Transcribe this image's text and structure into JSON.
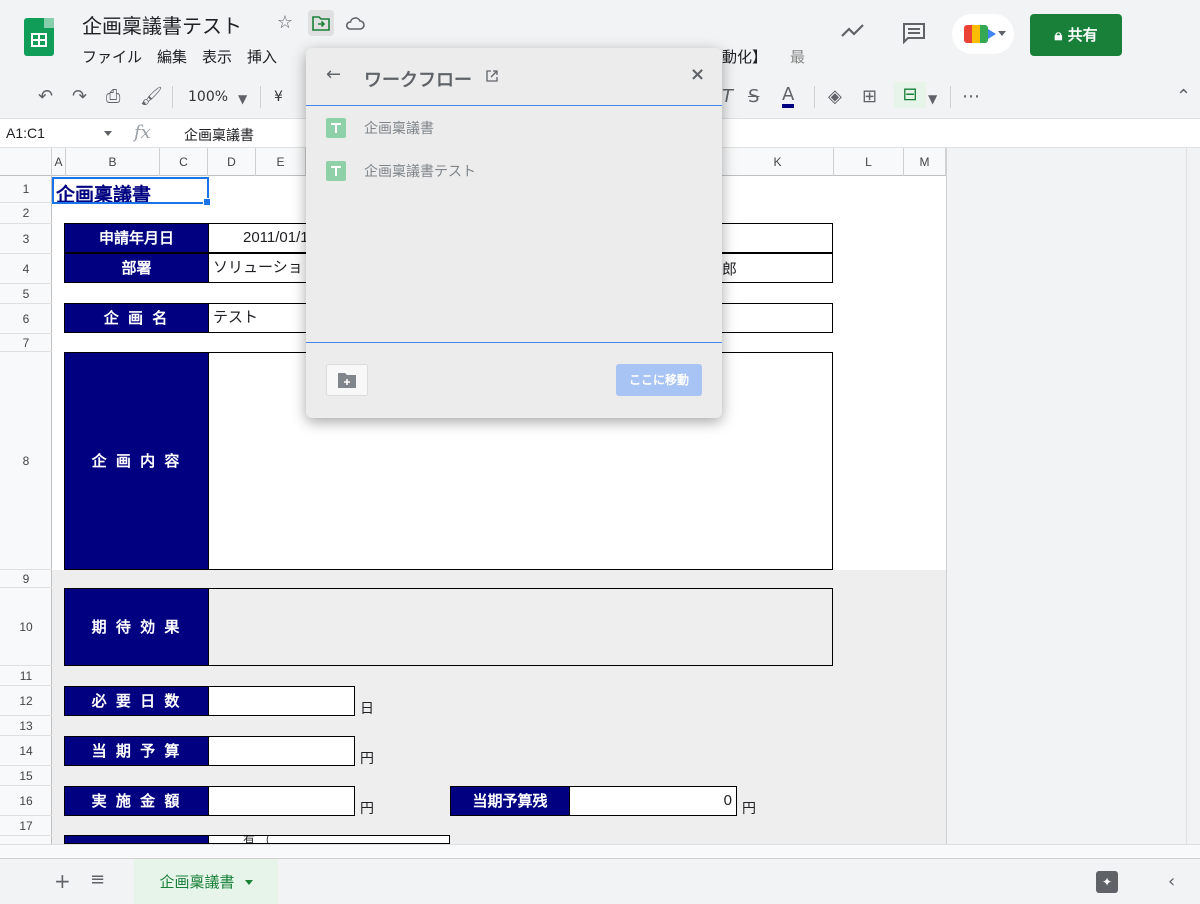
{
  "app": {
    "doc_title": "企画稟議書テスト",
    "menu": [
      "ファイル",
      "編集",
      "表示",
      "挿入"
    ],
    "menu_partial_1": "動化】",
    "menu_partial_2": "最",
    "share_label": "共有"
  },
  "toolbar": {
    "zoom": "100%",
    "currency": "¥"
  },
  "formula": {
    "namebox": "A1:C1",
    "fx": "fx",
    "value": "企画稟議書"
  },
  "columns": [
    "A",
    "B",
    "C",
    "D",
    "E",
    "K",
    "L",
    "M"
  ],
  "rows": [
    "1",
    "2",
    "3",
    "4",
    "5",
    "6",
    "7",
    "8",
    "9",
    "10",
    "11",
    "12",
    "13",
    "14",
    "15",
    "16",
    "17"
  ],
  "sheet": {
    "title": "企画稟議書",
    "labels": {
      "apply_date": "申請年月日",
      "department": "部署",
      "plan_name": "企 画 名",
      "plan_content": "企 画 内 容",
      "expected_effect": "期 待 効 果",
      "required_days": "必 要 日 数",
      "budget": "当 期 予 算",
      "amount": "実 施 金 額",
      "budget_remaining": "当期予算残"
    },
    "values": {
      "apply_date": "2011/01/1",
      "department": "ソリューショ",
      "department_right": "郎",
      "plan_name": "テスト",
      "budget_remaining": "0",
      "partial_row": "有 （"
    },
    "units": {
      "day": "日",
      "yen": "円"
    }
  },
  "tab": {
    "name": "企画稟議書"
  },
  "dialog": {
    "title": "ワークフロー",
    "items": [
      "企画稟議書",
      "企画稟議書テスト"
    ],
    "move_button": "ここに移動"
  }
}
